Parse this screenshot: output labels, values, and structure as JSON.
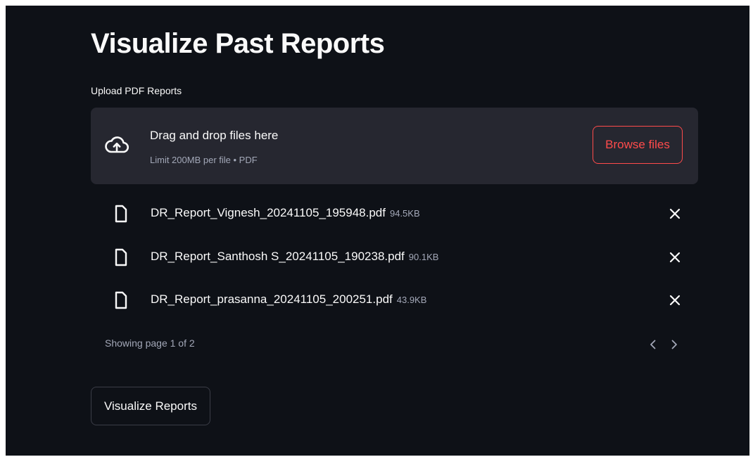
{
  "page": {
    "title": "Visualize Past Reports"
  },
  "uploader": {
    "label": "Upload PDF Reports",
    "drop_title": "Drag and drop files here",
    "drop_subtitle": "Limit 200MB per file • PDF",
    "browse_label": "Browse files",
    "icon": "cloud-upload-icon"
  },
  "files": [
    {
      "name": "DR_Report_Vignesh_20241105_195948.pdf",
      "size": "94.5KB",
      "icon": "file-icon"
    },
    {
      "name": "DR_Report_Santhosh S_20241105_190238.pdf",
      "size": "90.1KB",
      "icon": "file-icon"
    },
    {
      "name": "DR_Report_prasanna_20241105_200251.pdf",
      "size": "43.9KB",
      "icon": "file-icon"
    }
  ],
  "pagination": {
    "text": "Showing page 1 of 2"
  },
  "actions": {
    "visualize_label": "Visualize Reports"
  },
  "colors": {
    "background": "#0e1117",
    "panel": "#262730",
    "accent": "#ff4b4b",
    "text": "#fafafa",
    "muted": "#a3a8b8"
  }
}
